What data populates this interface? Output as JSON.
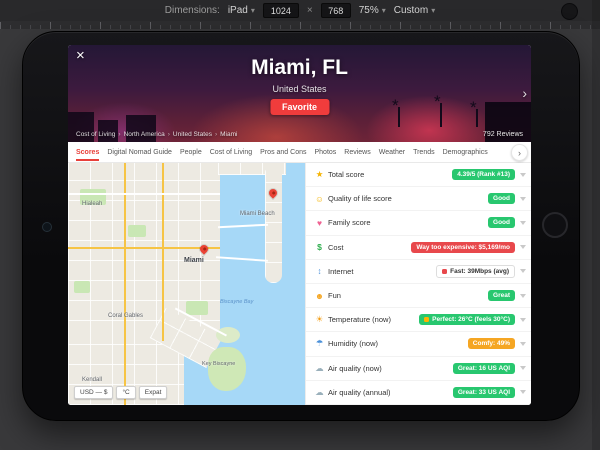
{
  "toolbar": {
    "dimensions_label": "Dimensions:",
    "device": "iPad",
    "width": "1024",
    "height": "768",
    "times": "×",
    "zoom": "75%",
    "mode": "Custom"
  },
  "icons": {
    "caret_down": "▾",
    "chevron_right": "›",
    "close": "×",
    "breadcrumb_sep": "›"
  },
  "page": {
    "title": "Miami, FL",
    "subtitle": "United States",
    "favorite_label": "Favorite",
    "reviews": "792 Reviews",
    "breadcrumb": [
      "Cost of Living",
      "North America",
      "United States",
      "Miami"
    ]
  },
  "tabs": {
    "active": "Scores",
    "items": [
      "Scores",
      "Digital Nomad Guide",
      "People",
      "Cost of Living",
      "Pros and Cons",
      "Photos",
      "Reviews",
      "Weather",
      "Trends",
      "Demographics"
    ]
  },
  "map": {
    "labels": [
      {
        "text": "Hialeah"
      },
      {
        "text": "Miami Beach"
      },
      {
        "text": "Miami"
      },
      {
        "text": "Coral Gables"
      },
      {
        "text": "Key Biscayne"
      },
      {
        "text": "Biscayne Bay"
      },
      {
        "text": "Kendall"
      }
    ],
    "controls": [
      "USD — $",
      "°C",
      "Expat"
    ]
  },
  "scores": {
    "rows": [
      {
        "icon": "trophy-icon",
        "label": "Total score",
        "badge": "4.39/5 (Rank #13)",
        "variant": "green"
      },
      {
        "icon": "smiley-icon",
        "label": "Quality of life score",
        "badge": "Good",
        "variant": "green"
      },
      {
        "icon": "family-icon",
        "label": "Family score",
        "badge": "Good",
        "variant": "green"
      },
      {
        "icon": "money-icon",
        "label": "Cost",
        "badge": "Way too expensive: $5,169/mo",
        "variant": "red"
      },
      {
        "icon": "wifi-icon",
        "label": "Internet",
        "badge": "Fast: 39Mbps (avg)",
        "variant": "light"
      },
      {
        "icon": "party-icon",
        "label": "Fun",
        "badge": "Great",
        "variant": "green"
      },
      {
        "icon": "thermometer-icon",
        "label": "Temperature (now)",
        "badge": "Perfect: 26°C (feels 30°C)",
        "variant": "green"
      },
      {
        "icon": "droplet-icon",
        "label": "Humidity (now)",
        "badge": "Comfy: 49%",
        "variant": "yellow"
      },
      {
        "icon": "wind-icon",
        "label": "Air quality (now)",
        "badge": "Great: 16 US AQI",
        "variant": "green"
      },
      {
        "icon": "wind-icon",
        "label": "Air quality (annual)",
        "badge": "Great: 33 US AQI",
        "variant": "green"
      }
    ]
  },
  "colors": {
    "accent_red": "#f03c3c",
    "badge_green": "#28c76f",
    "badge_red": "#e8484c",
    "badge_yellow": "#f5a623"
  }
}
